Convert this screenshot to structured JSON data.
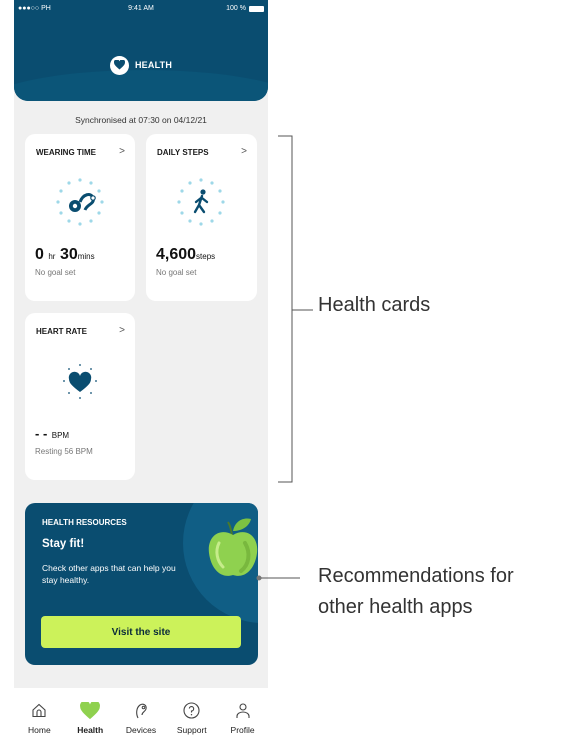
{
  "status_bar": {
    "carrier": "●●●○○ PH",
    "time": "9:41 AM",
    "battery": "100 %"
  },
  "header": {
    "title": "HEALTH",
    "icon": "heart-icon"
  },
  "sync_text": "Synchronised at 07:30 on 04/12/21",
  "cards": {
    "wearing_time": {
      "title": "WEARING TIME",
      "chevron": ">",
      "icon": "hearing-aid-icon",
      "hours": "0",
      "hours_unit": "hr",
      "minutes": "30",
      "minutes_unit": "mins",
      "goal": "No goal set"
    },
    "daily_steps": {
      "title": "DAILY STEPS",
      "chevron": ">",
      "icon": "walking-person-icon",
      "value": "4,600",
      "unit": "steps",
      "goal": "No goal set"
    },
    "heart_rate": {
      "title": "HEART RATE",
      "chevron": ">",
      "icon": "heart-icon",
      "value": "- -",
      "unit": "BPM",
      "resting": "Resting 56 BPM"
    }
  },
  "resources": {
    "label": "HEALTH RESOURCES",
    "title": "Stay fit!",
    "text": "Check other apps that can help you stay healthy.",
    "button": "Visit the site",
    "image": "green-apple"
  },
  "tabs": [
    {
      "label": "Home",
      "icon": "home-icon",
      "active": false
    },
    {
      "label": "Health",
      "icon": "heart-icon",
      "active": true
    },
    {
      "label": "Devices",
      "icon": "hearing-aid-icon",
      "active": false
    },
    {
      "label": "Support",
      "icon": "question-icon",
      "active": false
    },
    {
      "label": "Profile",
      "icon": "person-icon",
      "active": false
    }
  ],
  "annotations": {
    "cards": "Health cards",
    "recommendations_line1": "Recommendations for",
    "recommendations_line2": "other health apps"
  },
  "colors": {
    "primary": "#0a4d70",
    "accent": "#ccf25a",
    "icon_accent": "#8fd14f",
    "background": "#f0f0f0"
  }
}
